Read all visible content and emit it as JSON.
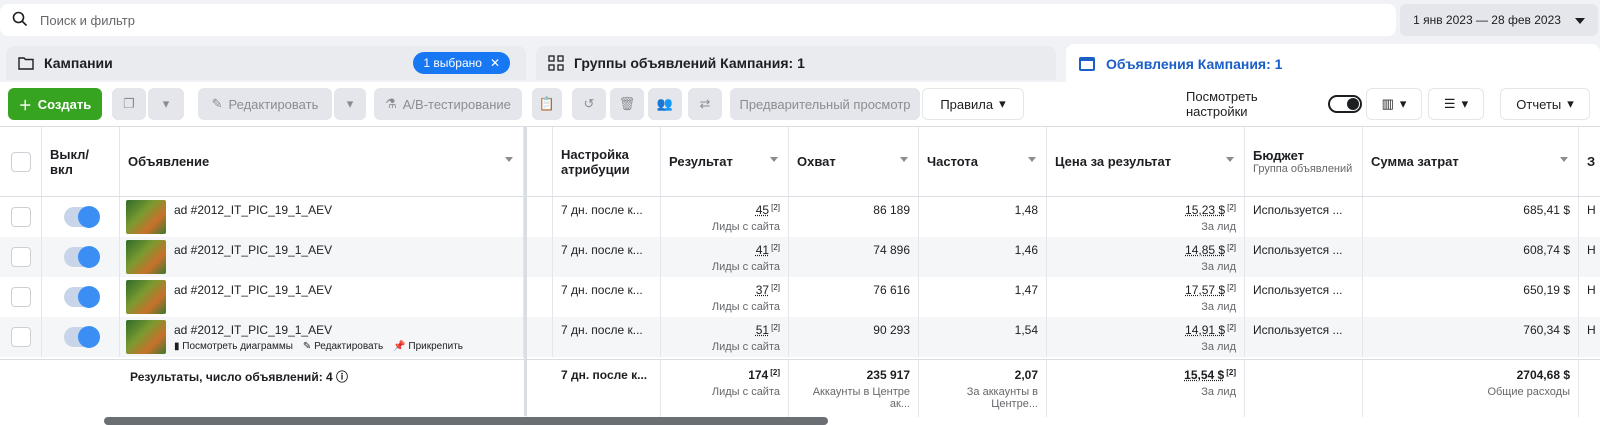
{
  "search": {
    "placeholder": "Поиск и фильтр"
  },
  "date_range": {
    "label": "1 янв 2023 — 28 фев 2023"
  },
  "tabs": {
    "campaigns": {
      "label": "Кампании",
      "badge": "1 выбрано"
    },
    "adsets": {
      "label": "Группы объявлений Кампания: 1"
    },
    "ads": {
      "label": "Объявления Кампания: 1"
    }
  },
  "toolbar": {
    "create": "Создать",
    "edit": "Редактировать",
    "ab_test": "A/B-тестирование",
    "preview": "Предварительный просмотр",
    "rules": "Правила",
    "view_settings": "Посмотреть настройки",
    "reports": "Отчеты"
  },
  "columns": {
    "onoff": "Выкл/ вкл",
    "ad": "Объявление",
    "attribution": "Настройка атрибуции",
    "result": "Результат",
    "reach": "Охват",
    "frequency": "Частота",
    "cost_per_result": "Цена за результат",
    "budget": "Бюджет",
    "budget_sub": "Группа объявлений",
    "spend": "Сумма затрат",
    "next": "З"
  },
  "rows": [
    {
      "name": "ad #2012_IT_PIC_19_1_AEV",
      "attribution": "7 дн. после к...",
      "result": "45",
      "result_note": "[2]",
      "result_sub": "Лиды с сайта",
      "reach": "86 189",
      "frequency": "1,48",
      "cpr": "15,23 $",
      "cpr_note": "[2]",
      "cpr_sub": "За лид",
      "budget": "Используется ...",
      "spend": "685,41 $",
      "next": "Н"
    },
    {
      "name": "ad #2012_IT_PIC_19_1_AEV",
      "attribution": "7 дн. после к...",
      "result": "41",
      "result_note": "[2]",
      "result_sub": "Лиды с сайта",
      "reach": "74 896",
      "frequency": "1,46",
      "cpr": "14,85 $",
      "cpr_note": "[2]",
      "cpr_sub": "За лид",
      "budget": "Используется ...",
      "spend": "608,74 $",
      "next": "Н"
    },
    {
      "name": "ad #2012_IT_PIC_19_1_AEV",
      "attribution": "7 дн. после к...",
      "result": "37",
      "result_note": "[2]",
      "result_sub": "Лиды с сайта",
      "reach": "76 616",
      "frequency": "1,47",
      "cpr": "17,57 $",
      "cpr_note": "[2]",
      "cpr_sub": "За лид",
      "budget": "Используется ...",
      "spend": "650,19 $",
      "next": "Н"
    },
    {
      "name": "ad #2012_IT_PIC_19_1_AEV",
      "attribution": "7 дн. после к...",
      "result": "51",
      "result_note": "[2]",
      "result_sub": "Лиды с сайта",
      "reach": "90 293",
      "frequency": "1,54",
      "cpr": "14,91 $",
      "cpr_note": "[2]",
      "cpr_sub": "За лид",
      "budget": "Используется ...",
      "spend": "760,34 $",
      "next": "Н"
    }
  ],
  "row_actions": {
    "charts": "Посмотреть диаграммы",
    "edit": "Редактировать",
    "pin": "Прикрепить"
  },
  "totals": {
    "label": "Результаты, число объявлений: 4",
    "attribution": "7 дн. после к...",
    "result": "174",
    "result_note": "[2]",
    "result_sub": "Лиды с сайта",
    "reach": "235 917",
    "reach_sub": "Аккаунты в Центре ак...",
    "frequency": "2,07",
    "frequency_sub": "За аккаунты в Центре...",
    "cpr": "15,54 $",
    "cpr_note": "[2]",
    "cpr_sub": "За лид",
    "spend": "2704,68 $",
    "spend_sub": "Общие расходы"
  }
}
